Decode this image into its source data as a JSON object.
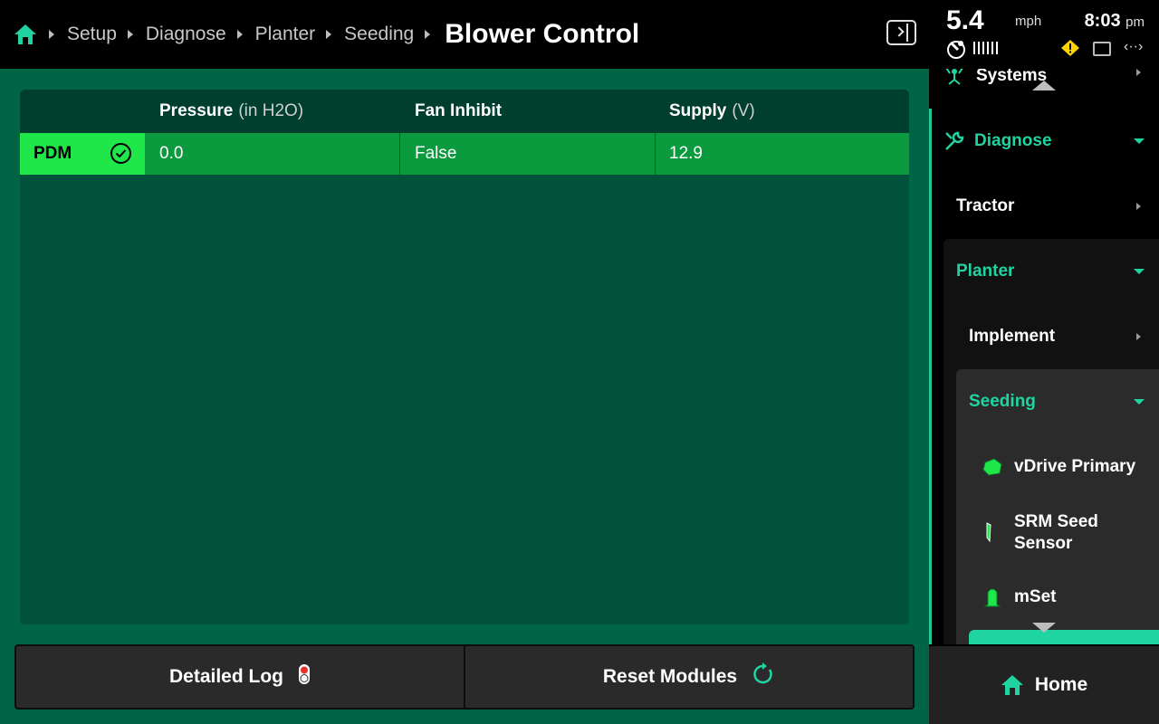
{
  "breadcrumb": {
    "items": [
      "Setup",
      "Diagnose",
      "Planter",
      "Seeding"
    ],
    "current": "Blower Control"
  },
  "status": {
    "speed": "5.4",
    "speed_unit": "mph",
    "time": "8:03",
    "time_suffix": "pm"
  },
  "table": {
    "headers": [
      {
        "label": "",
        "unit": ""
      },
      {
        "label": "Pressure",
        "unit": "(in H2O)"
      },
      {
        "label": "Fan Inhibit",
        "unit": ""
      },
      {
        "label": "Supply",
        "unit": "(V)"
      }
    ],
    "rows": [
      {
        "module": "PDM",
        "pressure": "0.0",
        "fan_inhibit": "False",
        "supply": "12.9"
      }
    ]
  },
  "buttons": {
    "detailed_log": "Detailed Log",
    "reset_modules": "Reset Modules"
  },
  "sidebar": {
    "systems": "Systems",
    "diagnose": "Diagnose",
    "tractor": "Tractor",
    "planter": "Planter",
    "implement": "Implement",
    "seeding": "Seeding",
    "vdrive": "vDrive Primary",
    "srm_line1": "SRM Seed",
    "srm_line2": "Sensor",
    "mset": "mSet"
  },
  "home": "Home",
  "colors": {
    "accent": "#1fd4a0",
    "row_active": "#0b9a3e",
    "row_label": "#1fe749",
    "main_bg": "#006544"
  },
  "icons": [
    "home-icon",
    "panel-toggle-icon",
    "gps-icon",
    "signal-icon",
    "warning-icon",
    "display-icon",
    "link-icon",
    "check-circle-icon",
    "traffic-light-icon",
    "refresh-icon",
    "systems-icon",
    "wrench-icon",
    "vdrive-icon",
    "seed-sensor-icon",
    "mset-icon"
  ]
}
